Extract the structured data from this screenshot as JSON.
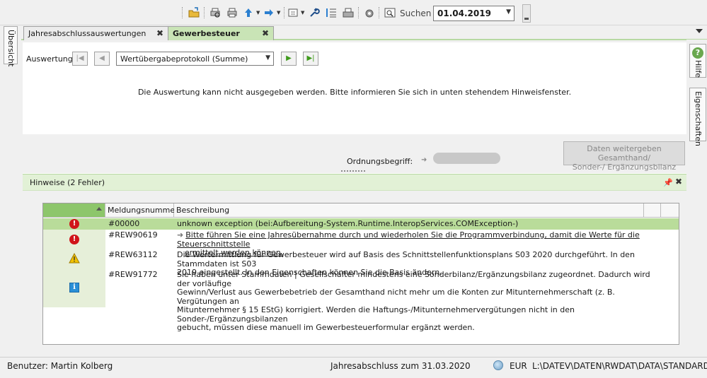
{
  "toolbar": {
    "search_label": "Suchen",
    "date_value": "01.04.2019",
    "icons": [
      "open-folder-icon",
      "print-preview-icon",
      "print-icon",
      "arrow-up-icon",
      "arrow-right-icon",
      "export-icon",
      "wrench-icon",
      "list-icon",
      "fax-icon",
      "lock-icon",
      "search-window-icon"
    ]
  },
  "left_tab": {
    "label": "Übersicht"
  },
  "right_tabs": {
    "help": "Hilfe",
    "properties": "Eigenschaften"
  },
  "doc_tabs": [
    {
      "label": "Jahresabschlussauswertungen",
      "active": false
    },
    {
      "label": "Gewerbesteuer",
      "active": true
    }
  ],
  "auswertung": {
    "label": "Auswertung:",
    "selected": "Wertübergabeprotokoll (Summe)"
  },
  "message": "Die Auswertung kann nicht ausgegeben werden. Bitte informieren Sie sich in unten stehendem Hinweisfenster.",
  "ordnung": {
    "label": "Ordnungsbegriff:"
  },
  "daten_button": {
    "line1": "Daten weitergeben Gesamthand/",
    "line2": "Sonder-/ Ergänzungsbilanz"
  },
  "hinweise": {
    "title": "Hinweise (2 Fehler)",
    "columns": [
      "Meldungsnummer",
      "Beschreibung"
    ],
    "rows": [
      {
        "type": "error",
        "number": "#00000",
        "lines": [
          "unknown  exception  (bei:Aufbereitung-System.Runtime.InteropServices.COMException-)"
        ]
      },
      {
        "type": "error",
        "number": "#REW90619",
        "lines": [
          "Bitte führen Sie eine Jahresübernahme durch und wiederholen Sie die Programmverbindung, damit die Werte für die Steuerschnittstelle",
          "ermittelt werden können."
        ]
      },
      {
        "type": "warning",
        "number": "#REW63112",
        "lines": [
          "Die Wertermittlung für Gewerbesteuer wird auf Basis des Schnittstellenfunktionsplans S03 2020 durchgeführt. In den Stammdaten ist S03",
          "2019 eingestellt. In den Eigenschaften können Sie die Basis ändern."
        ]
      },
      {
        "type": "info",
        "number": "#REW91772",
        "lines": [
          "Sie haben unter Stammdaten | Gesellschafter mindestens eine Sonderbilanz/Ergänzungsbilanz zugeordnet. Dadurch wird der vorläufige",
          "Gewinn/Verlust aus Gewerbebetrieb der Gesamthand nicht mehr um die Konten zur Mitunternehmerschaft (z. B. Vergütungen an",
          "Mitunternehmer § 15 EStG) korrigiert. Werden die Haftungs-/Mitunternehmervergütungen nicht in den Sonder-/Ergänzungsbilanzen",
          "gebucht, müssen diese manuell im Gewerbesteuerformular ergänzt werden."
        ]
      }
    ]
  },
  "statusbar": {
    "user": "Benutzer: Martin Kolberg",
    "period": "Jahresabschluss zum 31.03.2020",
    "currency": "EUR",
    "path": "L:\\DATEV\\DATEN\\RWDAT\\DATA\\STANDARD"
  },
  "colors": {
    "accent_green": "#8dc66b",
    "selected_row": "#b9dc9a",
    "error_red": "#d0141a",
    "info_blue": "#2a8fd6",
    "warning_yellow": "#f2c200"
  }
}
